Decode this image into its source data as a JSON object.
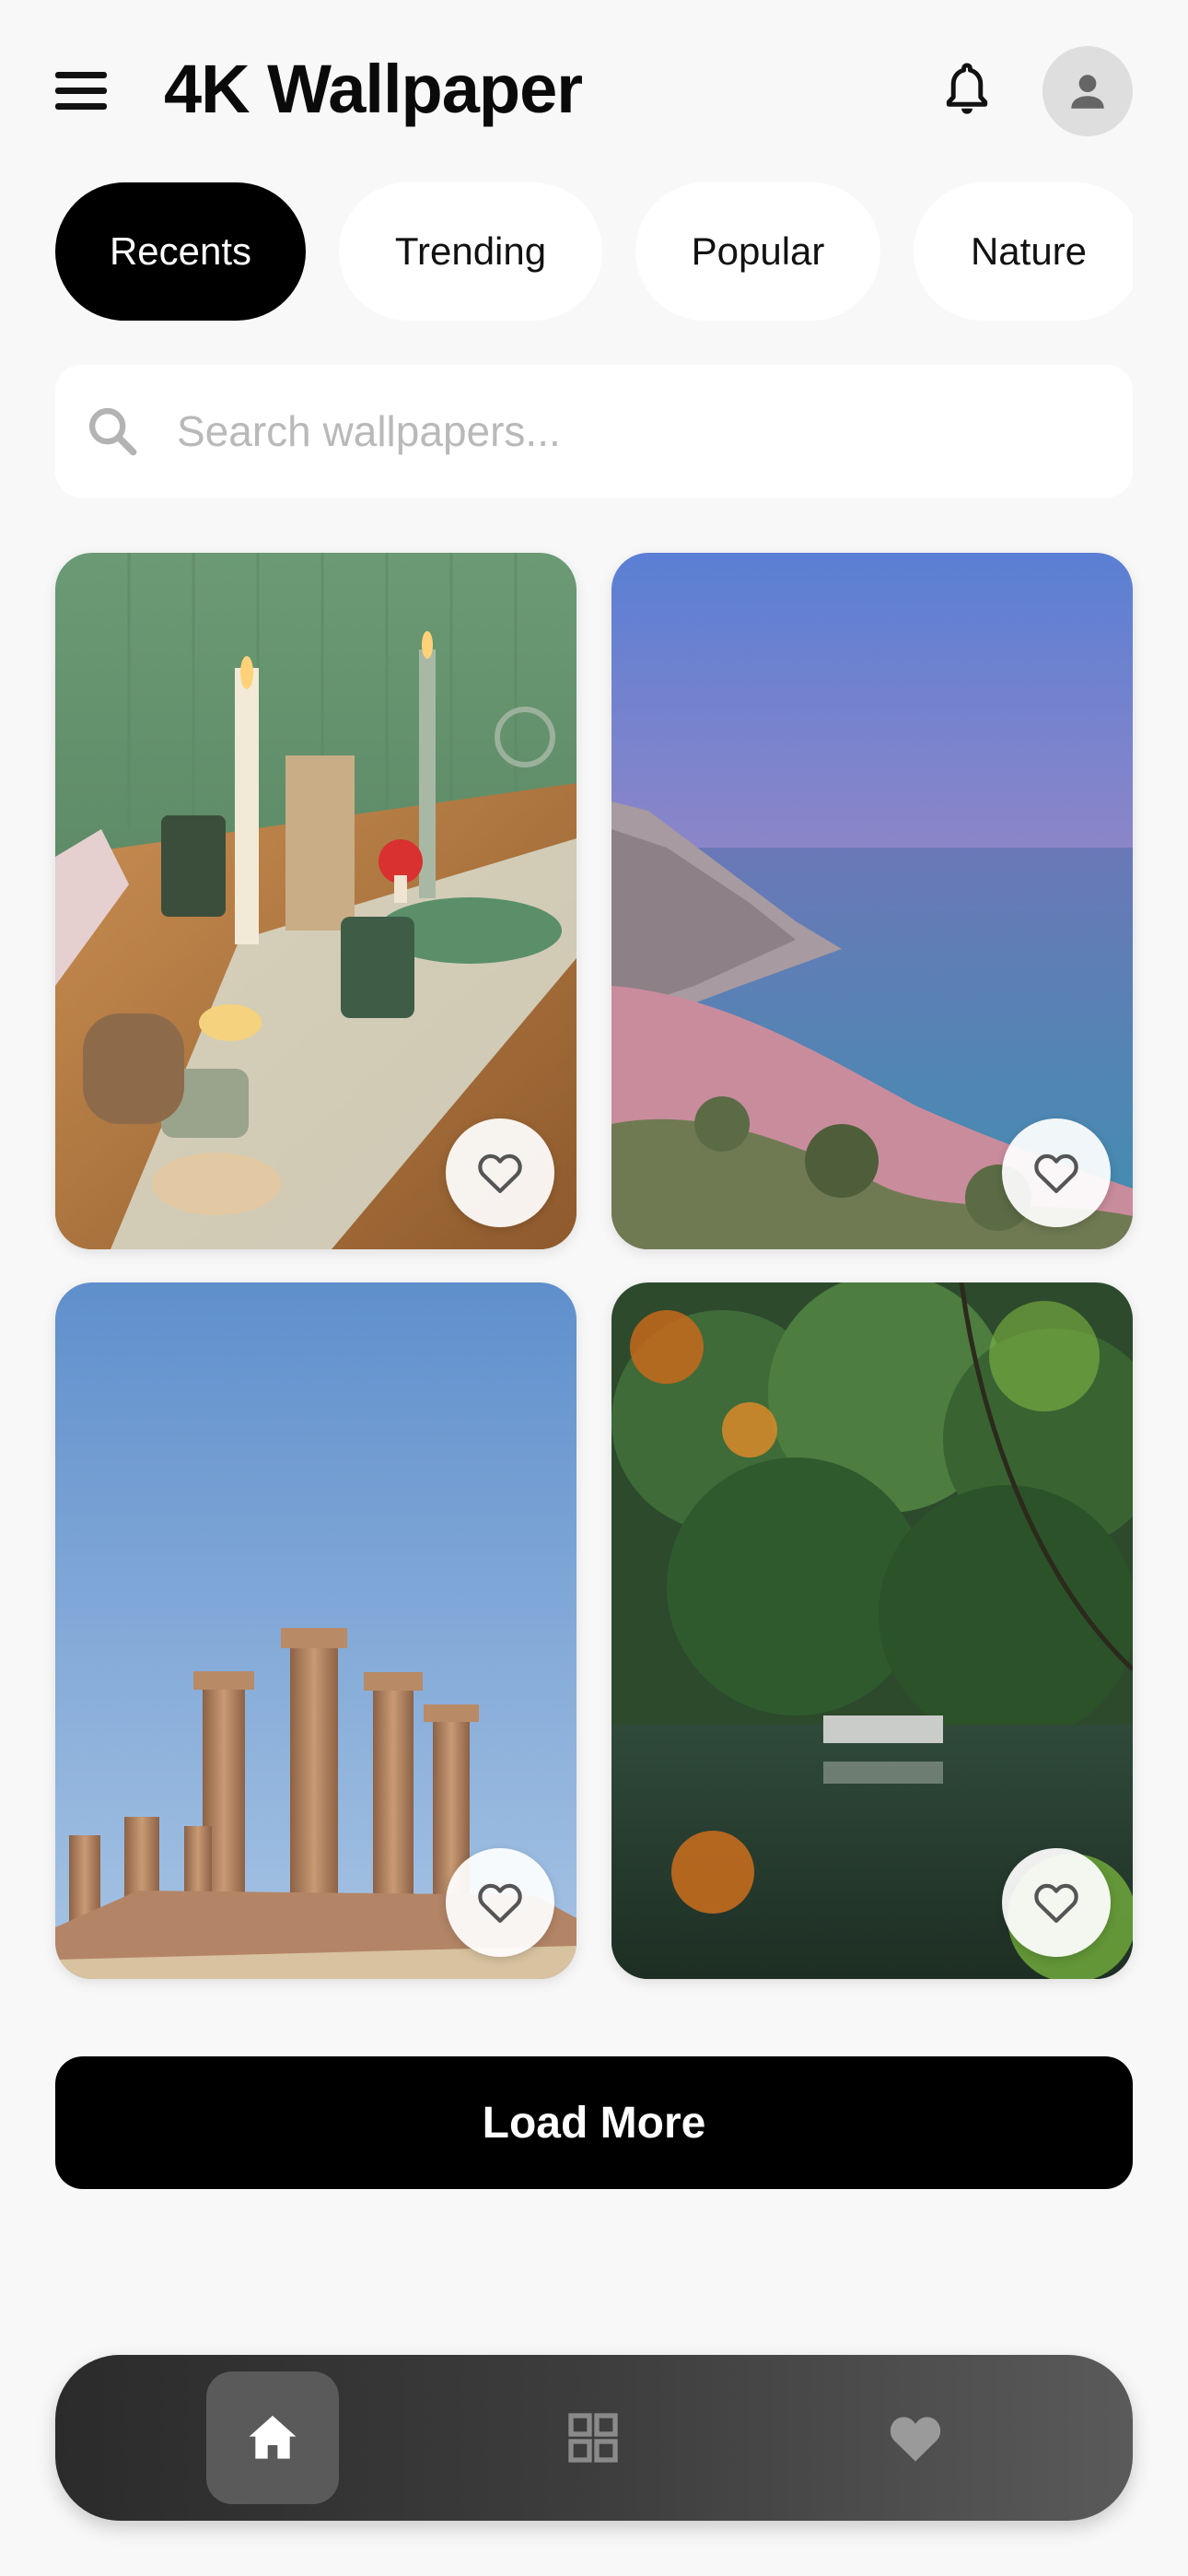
{
  "header": {
    "title": "4K Wallpaper",
    "menu_icon": "menu-icon",
    "bell_icon": "bell-icon",
    "avatar_icon": "person-icon"
  },
  "categories": [
    {
      "label": "Recents",
      "active": true
    },
    {
      "label": "Trending",
      "active": false
    },
    {
      "label": "Popular",
      "active": false
    },
    {
      "label": "Nature",
      "active": false
    }
  ],
  "search": {
    "placeholder": "Search wallpapers...",
    "value": ""
  },
  "wallpapers": [
    {
      "subject": "candle-table-photo",
      "favorite": false
    },
    {
      "subject": "coastal-beach-photo",
      "favorite": false
    },
    {
      "subject": "ancient-columns-photo",
      "favorite": false
    },
    {
      "subject": "forest-lake-photo",
      "favorite": false
    }
  ],
  "load_more_label": "Load More",
  "bottom_nav": {
    "items": [
      {
        "icon": "home-icon",
        "active": true
      },
      {
        "icon": "grid-icon",
        "active": false
      },
      {
        "icon": "heart-icon",
        "active": false
      }
    ]
  },
  "colors": {
    "background": "#f8f8f8",
    "accent": "#000000",
    "chip_inactive": "#ffffff"
  }
}
